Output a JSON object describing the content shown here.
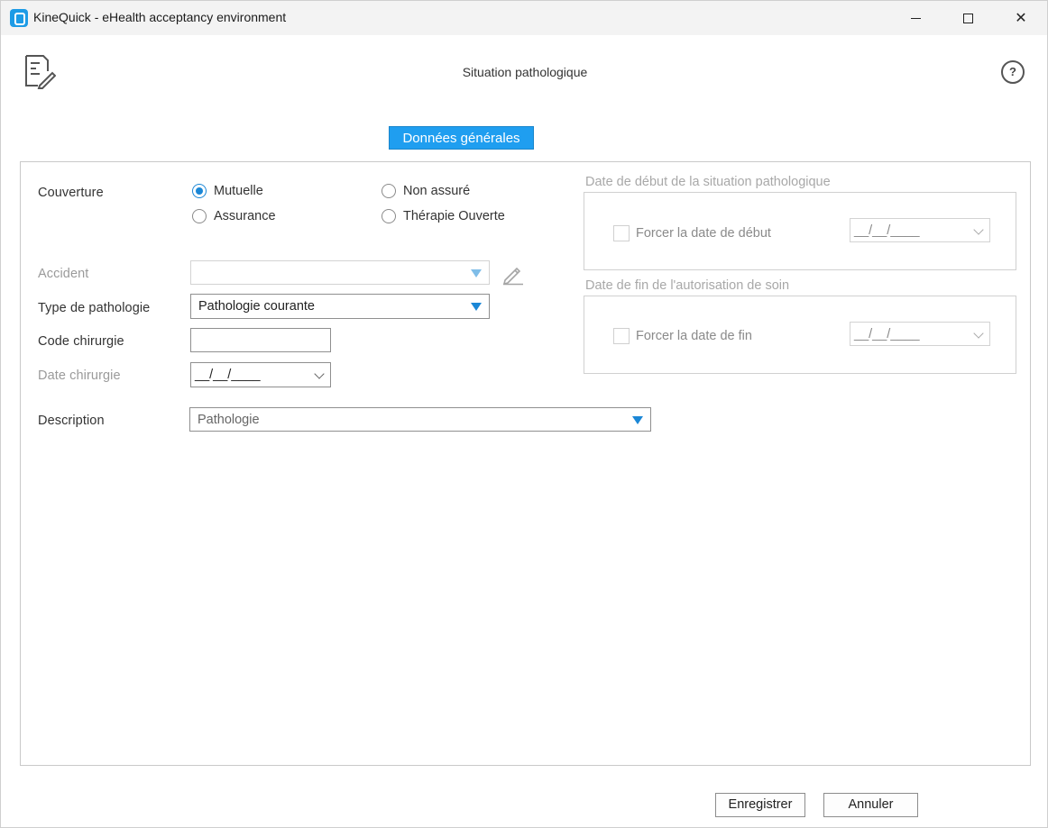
{
  "window": {
    "title": "KineQuick - eHealth acceptancy environment",
    "controls": {
      "close_glyph": "✕"
    }
  },
  "header": {
    "title": "Situation pathologique",
    "help_glyph": "?"
  },
  "tabs": [
    {
      "label": "Données générales",
      "active": true,
      "color": "#1f9ef0"
    }
  ],
  "form": {
    "couverture_label": "Couverture",
    "radios": [
      {
        "label": "Mutuelle",
        "checked": true
      },
      {
        "label": "Non assuré",
        "checked": false
      },
      {
        "label": "Assurance",
        "checked": false
      },
      {
        "label": "Thérapie Ouverte",
        "checked": false
      }
    ],
    "accident_label": "Accident",
    "accident_value": "",
    "type_label": "Type de pathologie",
    "type_value": "Pathologie courante",
    "code_label": "Code chirurgie",
    "code_value": "",
    "date_label": "Date chirurgie",
    "date_value": "__/__/____",
    "description_label": "Description",
    "description_value": "Pathologie"
  },
  "groups": {
    "debut": {
      "title": "Date de début de la situation pathologique",
      "checkbox_label": "Forcer la date de début",
      "date_value": "__/__/____"
    },
    "fin": {
      "title": "Date de fin de l'autorisation de soin",
      "checkbox_label": "Forcer la date de fin",
      "date_value": "__/__/____"
    }
  },
  "footer": {
    "save_label": "Enregistrer",
    "cancel_label": "Annuler"
  },
  "colors": {
    "accent": "#1f9ef0",
    "radio_checked": "#1b87d6"
  }
}
